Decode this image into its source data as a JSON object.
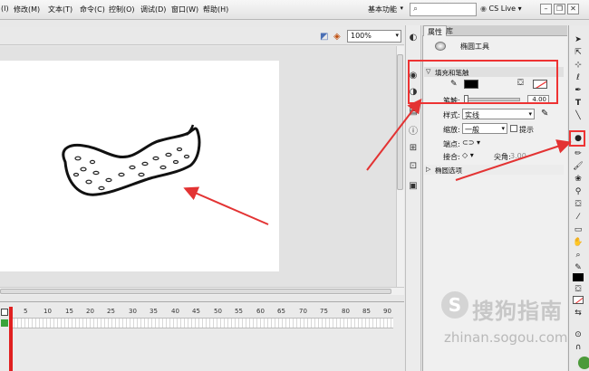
{
  "menubar": {
    "items": [
      "(I)",
      "修改(M)",
      "文本(T)",
      "命令(C)",
      "控制(O)",
      "调试(D)",
      "窗口(W)",
      "帮助(H)"
    ],
    "workspace_label": "基本功能",
    "search_placeholder": "",
    "cs_live": "CS Live"
  },
  "stage": {
    "zoom": "100%"
  },
  "timeline": {
    "ticks": [
      "5",
      "10",
      "15",
      "20",
      "25",
      "30",
      "35",
      "40",
      "45",
      "50",
      "55",
      "60",
      "65",
      "70",
      "75",
      "80",
      "85",
      "90"
    ]
  },
  "panel": {
    "tabs": [
      "属性",
      "库"
    ],
    "tool_name": "椭圆工具",
    "section_fill_stroke": "填充和笔触",
    "stroke_label": "笔触:",
    "stroke_value": "4.00",
    "style_label": "样式:",
    "style_value": "实线",
    "scale_label": "缩放:",
    "scale_value": "一般",
    "hint_label": "提示",
    "cap_label": "端点:",
    "join_label": "接合:",
    "miter_label": "尖角:",
    "miter_value": "3.00",
    "section_ellipse": "椭圆选项"
  },
  "watermark": {
    "brand": "搜狗指南",
    "url": "zhinan.sogou.com"
  },
  "colors": {
    "annotation_red": "#e33333",
    "stroke_color": "#000000",
    "fill_color": "#ffffff"
  }
}
